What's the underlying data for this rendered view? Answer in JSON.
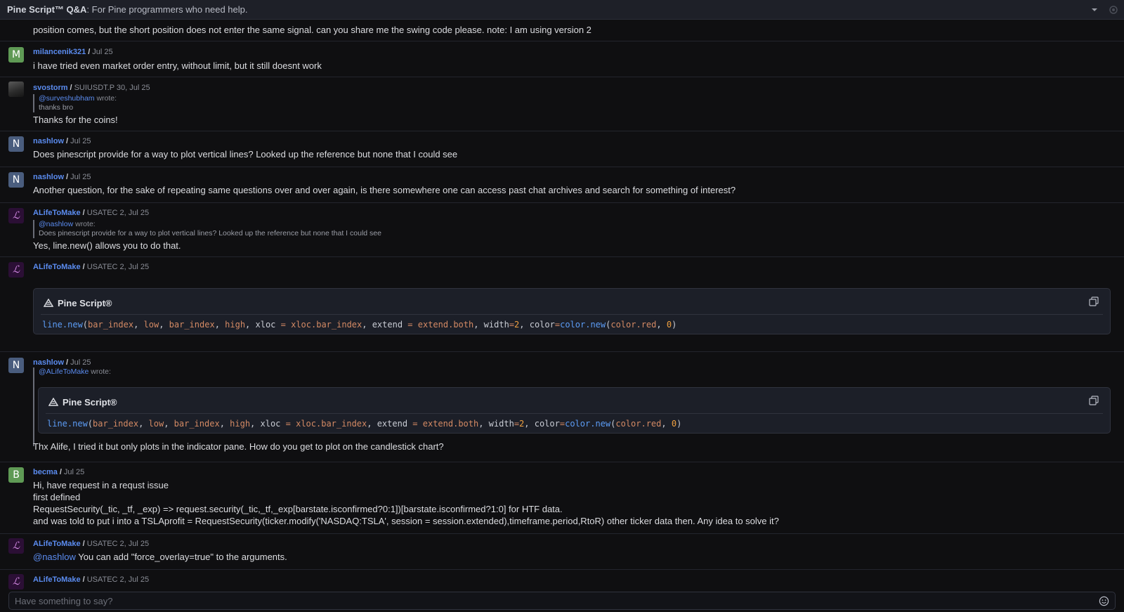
{
  "header": {
    "title_bold": "Pine Script™ Q&A",
    "title_rest": ": For Pine programmers who need help."
  },
  "messages": [
    {
      "text": "position comes, but the short position does not enter the same signal. can you share me the swing code please. note: I am using version 2"
    },
    {
      "avatar": "M",
      "user": "milancenik321",
      "meta": "Jul 25",
      "text": "i have tried even market order entry, without limit, but it still doesnt work"
    },
    {
      "avatar": "",
      "user": "svostorm",
      "meta": "SUIUSDT.P 30, Jul 25",
      "quote_user": "@surveshubham",
      "quote_wrote": " wrote:",
      "quote_text": "thanks bro",
      "text": "Thanks for the coins!"
    },
    {
      "avatar": "N",
      "user": "nashlow",
      "meta": "Jul 25",
      "text": "Does pinescript provide for a way to plot vertical lines? Looked up the reference but none that I could see"
    },
    {
      "avatar": "N",
      "user": "nashlow",
      "meta": "Jul 25",
      "text": "Another question, for the sake of repeating same questions over and over again, is there somewhere one can access past chat archives and search for something of interest?"
    },
    {
      "avatar": "L",
      "user": "ALifeToMake",
      "meta": "USATEC 2, Jul 25",
      "quote_user": "@nashlow",
      "quote_wrote": " wrote:",
      "quote_text": "Does pinescript provide for a way to plot vertical lines? Looked up the reference but none that I could see",
      "text": "Yes, line.new() allows you to do that."
    },
    {
      "avatar": "L",
      "user": "ALifeToMake",
      "meta": "USATEC 2, Jul 25",
      "code_label": "Pine Script®"
    },
    {
      "avatar": "N",
      "user": "nashlow",
      "meta": "Jul 25",
      "quote_user": "@ALifeToMake",
      "quote_wrote": " wrote:",
      "code_label": "Pine Script®",
      "text": "Thx Alife, I tried it but only plots in the indicator pane. How do you get to plot on the candlestick chart?"
    },
    {
      "avatar": "B",
      "user": "becma",
      "meta": "Jul 25",
      "lines": [
        "Hi, have request in a requst issue",
        "first defined",
        "RequestSecurity(_tic, _tf, _exp) => request.security(_tic,_tf,_exp[barstate.isconfirmed?0:1])[barstate.isconfirmed?1:0] for HTF data.",
        "and was told to put i into a TSLAprofit = RequestSecurity(ticker.modify('NASDAQ:TSLA', session = session.extended),timeframe.period,RtoR) other ticker data then. Any idea to solve it?"
      ]
    },
    {
      "avatar": "L",
      "user": "ALifeToMake",
      "meta": "USATEC 2, Jul 25",
      "mention": "@nashlow",
      "text": " You can add \"force_overlay=true\" to the arguments."
    },
    {
      "avatar": "L",
      "user": "ALifeToMake",
      "meta": "USATEC 2, Jul 25"
    }
  ],
  "code": {
    "t1": "line.new",
    "t2": "(",
    "t3": "bar_index",
    "t4": ", ",
    "t5": "low",
    "t6": ", ",
    "t7": "bar_index",
    "t8": ", ",
    "t9": "high",
    "t10": ", xloc ",
    "t11": "=",
    "t12": " ",
    "t13": "xloc.bar_index",
    "t14": ", extend ",
    "t15": "=",
    "t16": " ",
    "t17": "extend.both",
    "t18": ", width",
    "t19": "=",
    "t20": "2",
    "t21": ", color",
    "t22": "=",
    "t23": "color.new",
    "t24": "(",
    "t25": "color.red",
    "t26": ", ",
    "t27": "0",
    "t28": ")"
  },
  "composer": {
    "placeholder": "Have something to say?"
  },
  "icons": {
    "dropdown": "chevron-down-icon",
    "settings": "gear-icon",
    "copy": "copy-icon",
    "pine": "pine-logo-icon",
    "emoji": "emoji-icon"
  }
}
